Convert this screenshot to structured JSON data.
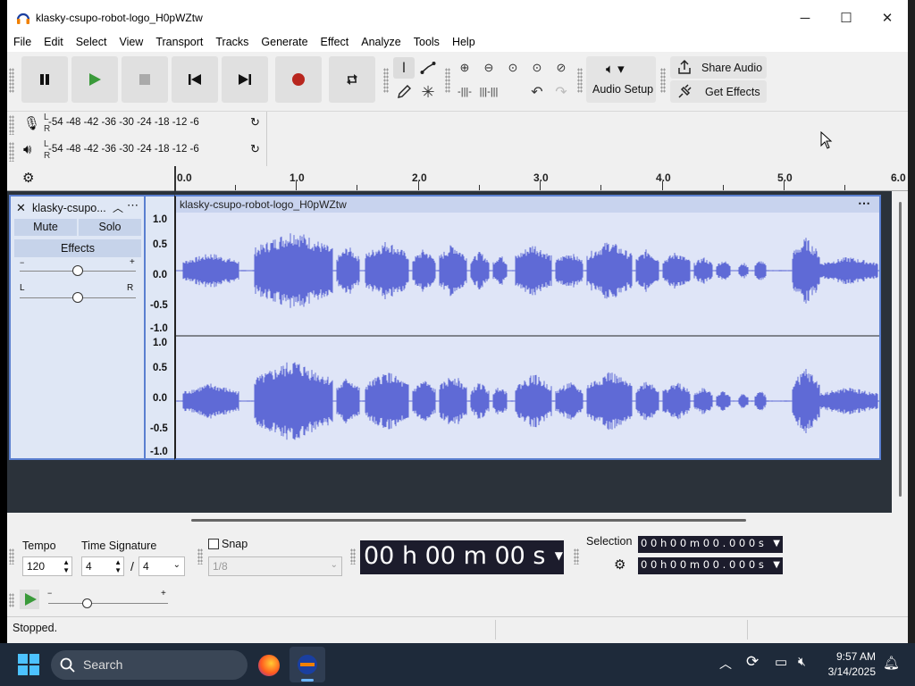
{
  "window": {
    "title": "klasky-csupo-robot-logo_H0pWZtw",
    "minimize": "─",
    "maximize": "☐",
    "close": "✕"
  },
  "menu": [
    "File",
    "Edit",
    "Select",
    "View",
    "Transport",
    "Tracks",
    "Generate",
    "Effect",
    "Analyze",
    "Tools",
    "Help"
  ],
  "toolbar": {
    "audio_setup": "Audio Setup",
    "share_audio": "Share Audio",
    "get_effects": "Get Effects"
  },
  "meters": {
    "scale": "-54  -48  -42  -36  -30  -24  -18  -12  -6",
    "left": "L",
    "right": "R"
  },
  "ruler": {
    "labels": [
      "0.0",
      "1.0",
      "2.0",
      "3.0",
      "4.0",
      "5.0",
      "6.0"
    ]
  },
  "track": {
    "name": "klasky-csupo...",
    "mute": "Mute",
    "solo": "Solo",
    "effects": "Effects",
    "gain_minus": "−",
    "gain_plus": "+",
    "pan_left": "L",
    "pan_right": "R",
    "clip_name": "klasky-csupo-robot-logo_H0pWZtw",
    "scale_labels": [
      "1.0",
      "0.5",
      "0.0",
      "-0.5",
      "-1.0"
    ]
  },
  "bottom": {
    "tempo_label": "Tempo",
    "tempo_value": "120",
    "time_sig_label": "Time Signature",
    "time_sig_num": "4",
    "time_sig_sep": "/",
    "time_sig_den": "4",
    "snap_label": "Snap",
    "snap_value": "1/8",
    "time_display": "00 h 00 m 00 s",
    "selection_label": "Selection",
    "selection_start": "0 0 h 0 0 m 0 0 . 0 0 0 s",
    "selection_end": "0 0 h 0 0 m 0 0 . 0 0 0 s",
    "play_minus": "−",
    "play_plus": "+"
  },
  "status": "Stopped.",
  "taskbar": {
    "search": "Search",
    "time": "9:57 AM",
    "date": "3/14/2025"
  }
}
